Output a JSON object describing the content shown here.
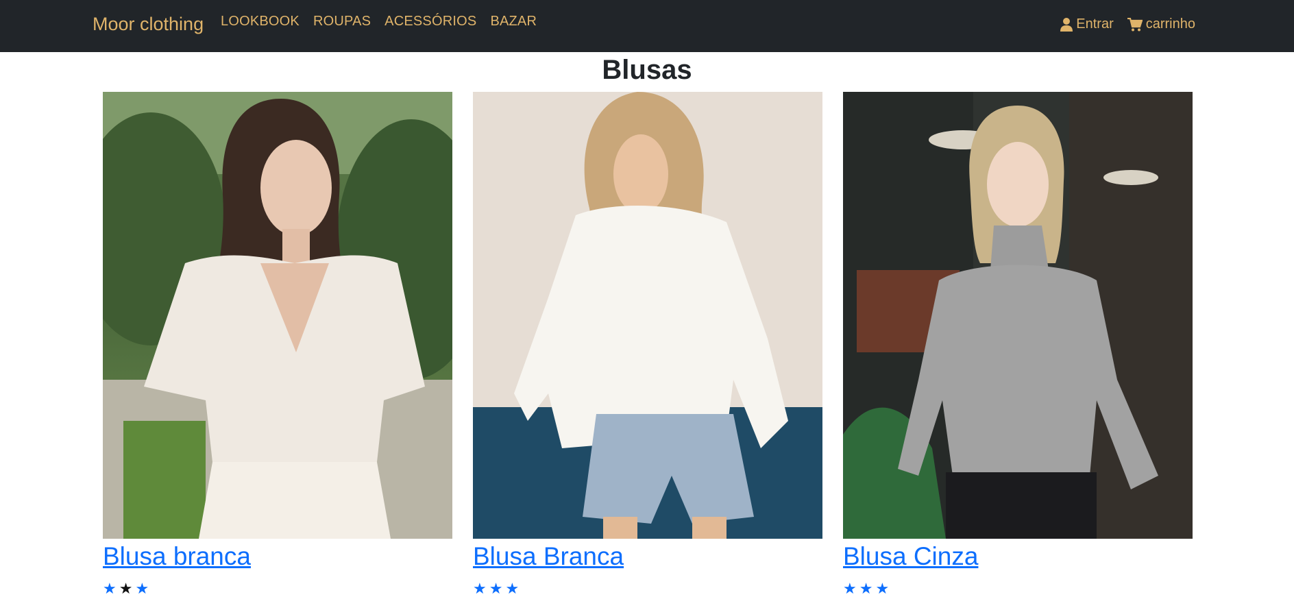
{
  "nav": {
    "brand": "Moor clothing",
    "links": [
      "LOOKBOOK",
      "ROUPAS",
      "ACESSÓRIOS",
      "BAZAR"
    ],
    "login_label": "Entrar",
    "cart_label": "carrinho"
  },
  "page": {
    "title": "Blusas"
  },
  "products": [
    {
      "name": "Blusa branca",
      "rating": 3,
      "stars": [
        "on",
        "off",
        "on"
      ]
    },
    {
      "name": "Blusa Branca",
      "rating": 3,
      "stars": [
        "on",
        "on",
        "on"
      ]
    },
    {
      "name": "Blusa Cinza",
      "rating": 3,
      "stars": [
        "on",
        "on",
        "on"
      ]
    }
  ],
  "colors": {
    "navbar_bg": "#212529",
    "nav_text": "#e0b46a",
    "link": "#0d6efd"
  }
}
